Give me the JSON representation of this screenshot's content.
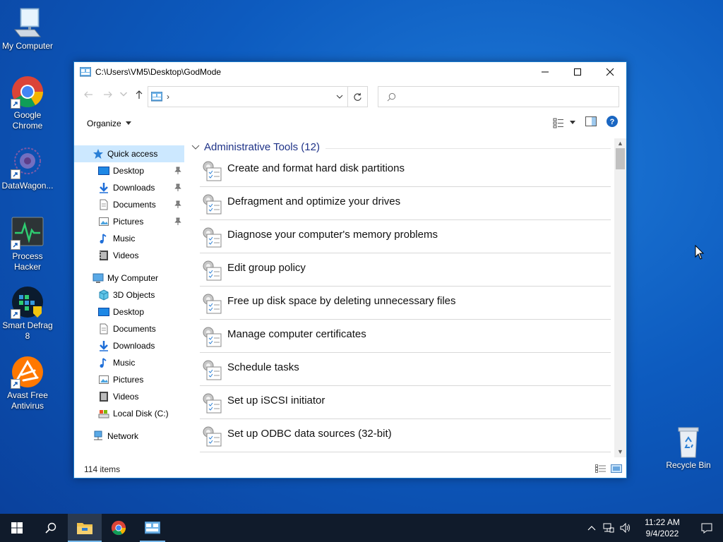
{
  "desktop": {
    "icons": [
      {
        "label": "My Computer"
      },
      {
        "label": "Google Chrome"
      },
      {
        "label": "DataWagon..."
      },
      {
        "label": "Process Hacker"
      },
      {
        "label": "Smart Defrag 8"
      },
      {
        "label": "Avast Free Antivirus"
      },
      {
        "label": "Recycle Bin"
      }
    ]
  },
  "window": {
    "title": "C:\\Users\\VM5\\Desktop\\GodMode",
    "address_chevron": "›",
    "search_placeholder": "",
    "organize_label": "Organize",
    "status_text": "114 items"
  },
  "navpane": {
    "quick_access": "Quick access",
    "quick_items": [
      {
        "label": "Desktop",
        "icon": "desktop-icon"
      },
      {
        "label": "Downloads",
        "icon": "downloads-icon"
      },
      {
        "label": "Documents",
        "icon": "documents-icon"
      },
      {
        "label": "Pictures",
        "icon": "pictures-icon"
      },
      {
        "label": "Music",
        "icon": "music-icon"
      },
      {
        "label": "Videos",
        "icon": "videos-icon"
      }
    ],
    "my_computer": "My Computer",
    "computer_items": [
      {
        "label": "3D Objects"
      },
      {
        "label": "Desktop"
      },
      {
        "label": "Documents"
      },
      {
        "label": "Downloads"
      },
      {
        "label": "Music"
      },
      {
        "label": "Pictures"
      },
      {
        "label": "Videos"
      },
      {
        "label": "Local Disk (C:)"
      }
    ],
    "network": "Network"
  },
  "content": {
    "group_title": "Administrative Tools (12)",
    "items": [
      "Create and format hard disk partitions",
      "Defragment and optimize your drives",
      "Diagnose your computer's memory problems",
      "Edit group policy",
      "Free up disk space by deleting unnecessary files",
      "Manage computer certificates",
      "Schedule tasks",
      "Set up iSCSI initiator",
      "Set up ODBC data sources (32-bit)"
    ]
  },
  "taskbar": {
    "time": "11:22 AM",
    "date": "9/4/2022"
  },
  "colors": {
    "accent": "#1979ca",
    "nav_selected": "#cce8ff",
    "group_header": "#1e3287",
    "taskbar": "#101b2b"
  }
}
